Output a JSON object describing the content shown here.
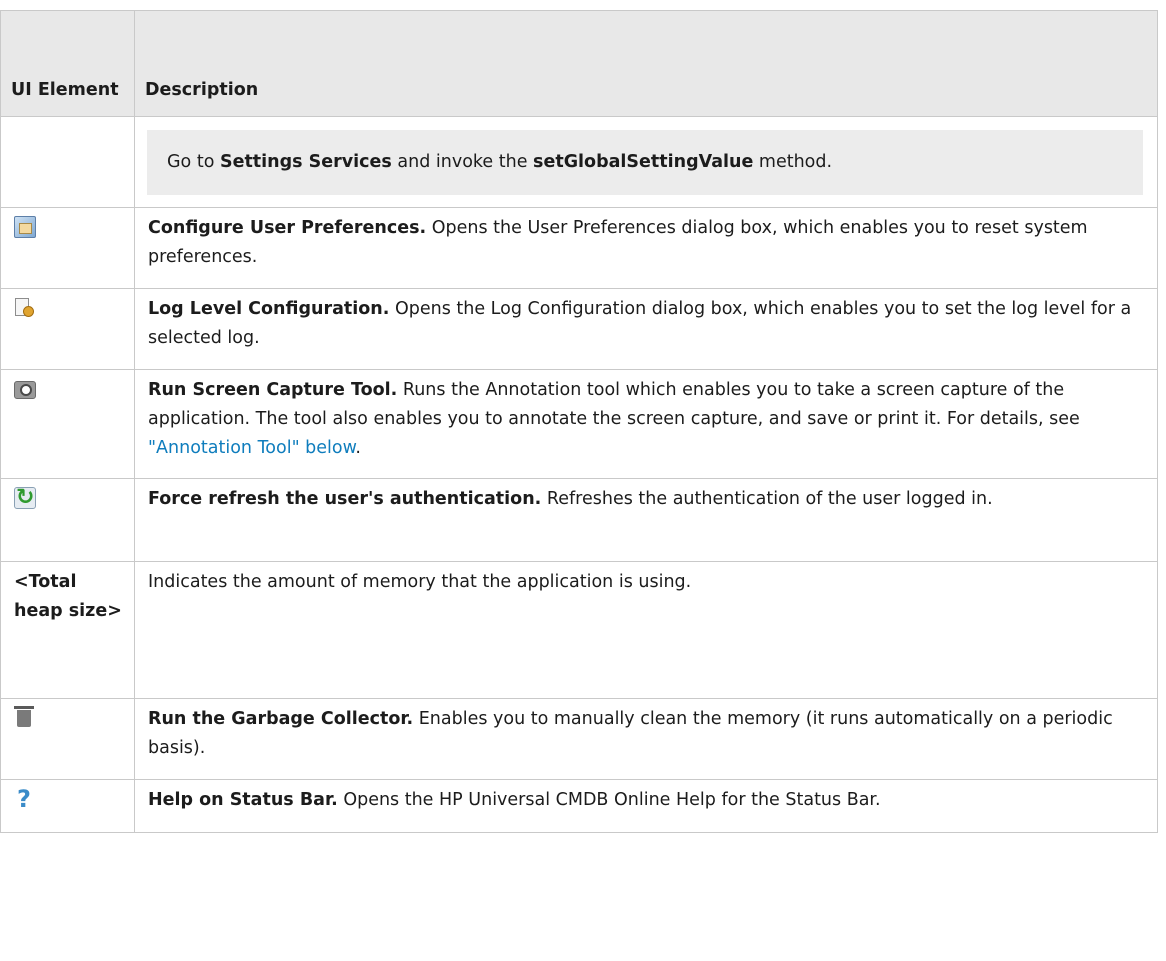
{
  "header": {
    "col1": "UI Element",
    "col2": "Description"
  },
  "note": {
    "prefix": "Go to ",
    "service": "Settings Services",
    "middle": " and invoke the ",
    "method": "setGlobalSettingValue",
    "suffix": " method."
  },
  "rows": [
    {
      "icon": "user-preferences-icon",
      "label": "Configure User Preferences.",
      "text": " Opens the User Preferences dialog box, which enables you to reset system preferences."
    },
    {
      "icon": "log-configuration-icon",
      "label": "Log Level Configuration.",
      "text": " Opens the Log Configuration dialog box, which enables you to set the log level for a selected log."
    },
    {
      "icon": "camera-icon",
      "label": "Run Screen Capture Tool.",
      "text": " Runs the Annotation tool which enables you to take a screen capture of the application. The tool also enables you to annotate the screen capture, and save or print it. For details, see ",
      "link": "\"Annotation Tool\" below",
      "after": "."
    },
    {
      "icon": "refresh-icon",
      "label": "Force refresh the user's authentication.",
      "text": " Refreshes the authentication of the user logged in."
    },
    {
      "element": "<Total heap size>",
      "text": "Indicates the amount of memory that the application is using."
    },
    {
      "icon": "trash-icon",
      "label": "Run the Garbage Collector.",
      "text": " Enables you to manually clean the memory (it runs automatically on a periodic basis)."
    },
    {
      "icon": "help-icon",
      "label": "Help on Status Bar.",
      "text": " Opens the HP Universal CMDB Online Help for the Status Bar."
    }
  ]
}
